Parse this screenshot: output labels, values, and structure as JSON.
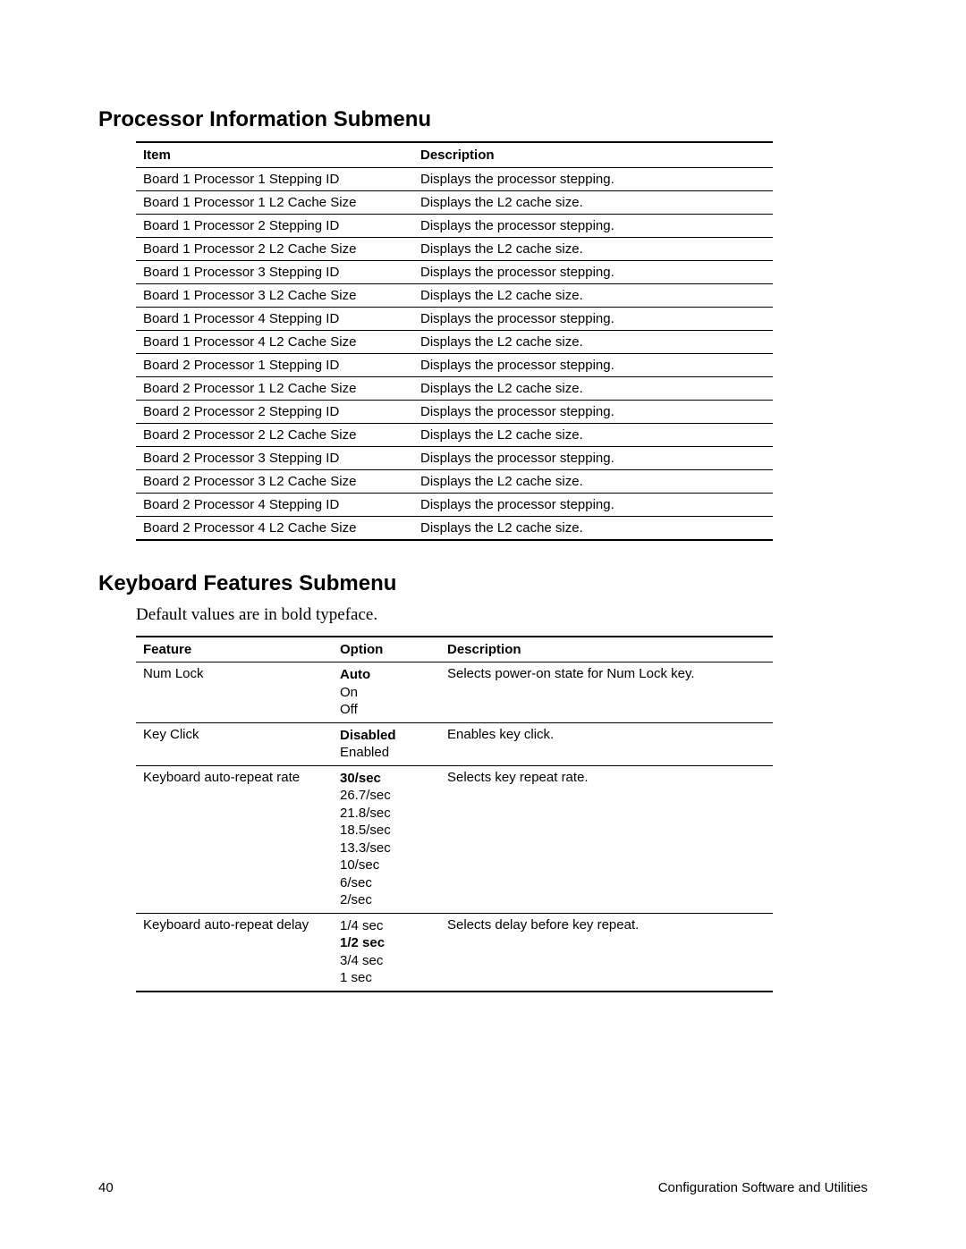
{
  "section1": {
    "title": "Processor Information Submenu",
    "headers": {
      "item": "Item",
      "description": "Description"
    },
    "rows": [
      {
        "item": "Board 1 Processor 1 Stepping ID",
        "desc": "Displays the processor stepping."
      },
      {
        "item": "Board 1 Processor 1 L2 Cache Size",
        "desc": "Displays the L2 cache size."
      },
      {
        "item": "Board 1 Processor 2 Stepping ID",
        "desc": "Displays the processor stepping."
      },
      {
        "item": "Board 1 Processor 2 L2 Cache Size",
        "desc": "Displays the L2 cache size."
      },
      {
        "item": "Board 1 Processor 3 Stepping ID",
        "desc": "Displays the processor stepping."
      },
      {
        "item": "Board 1 Processor 3 L2 Cache Size",
        "desc": "Displays the L2 cache size."
      },
      {
        "item": "Board 1 Processor 4 Stepping ID",
        "desc": "Displays the processor stepping."
      },
      {
        "item": "Board 1 Processor 4 L2 Cache Size",
        "desc": "Displays the L2 cache size."
      },
      {
        "item": "Board 2 Processor 1 Stepping ID",
        "desc": "Displays the processor stepping."
      },
      {
        "item": "Board 2 Processor 1 L2 Cache Size",
        "desc": "Displays the L2 cache size."
      },
      {
        "item": "Board 2 Processor 2 Stepping ID",
        "desc": "Displays the processor stepping."
      },
      {
        "item": "Board 2 Processor 2 L2 Cache Size",
        "desc": "Displays the L2 cache size."
      },
      {
        "item": "Board 2 Processor 3 Stepping ID",
        "desc": "Displays the processor stepping."
      },
      {
        "item": "Board 2 Processor 3 L2 Cache Size",
        "desc": "Displays the L2 cache size."
      },
      {
        "item": "Board 2 Processor 4 Stepping ID",
        "desc": "Displays the processor stepping."
      },
      {
        "item": "Board 2 Processor 4 L2 Cache Size",
        "desc": "Displays the L2 cache size."
      }
    ]
  },
  "section2": {
    "title": "Keyboard Features Submenu",
    "note": "Default values are in bold typeface.",
    "headers": {
      "feature": "Feature",
      "option": "Option",
      "description": "Description"
    },
    "rows": [
      {
        "feature": "Num Lock",
        "options": [
          {
            "text": "Auto",
            "bold": true
          },
          {
            "text": "On",
            "bold": false
          },
          {
            "text": "Off",
            "bold": false
          }
        ],
        "desc": "Selects power-on state for Num Lock key."
      },
      {
        "feature": "Key Click",
        "options": [
          {
            "text": "Disabled",
            "bold": true
          },
          {
            "text": "Enabled",
            "bold": false
          }
        ],
        "desc": "Enables key click."
      },
      {
        "feature": "Keyboard auto-repeat rate",
        "options": [
          {
            "text": "30/sec",
            "bold": true
          },
          {
            "text": "26.7/sec",
            "bold": false
          },
          {
            "text": "21.8/sec",
            "bold": false
          },
          {
            "text": "18.5/sec",
            "bold": false
          },
          {
            "text": "13.3/sec",
            "bold": false
          },
          {
            "text": "10/sec",
            "bold": false
          },
          {
            "text": "6/sec",
            "bold": false
          },
          {
            "text": "2/sec",
            "bold": false
          }
        ],
        "desc": "Selects key repeat rate."
      },
      {
        "feature": "Keyboard auto-repeat delay",
        "options": [
          {
            "text": "1/4 sec",
            "bold": false
          },
          {
            "text": "1/2 sec",
            "bold": true
          },
          {
            "text": "3/4 sec",
            "bold": false
          },
          {
            "text": "1 sec",
            "bold": false
          }
        ],
        "desc": "Selects delay before key repeat."
      }
    ]
  },
  "footer": {
    "page": "40",
    "title": "Configuration Software and Utilities"
  }
}
